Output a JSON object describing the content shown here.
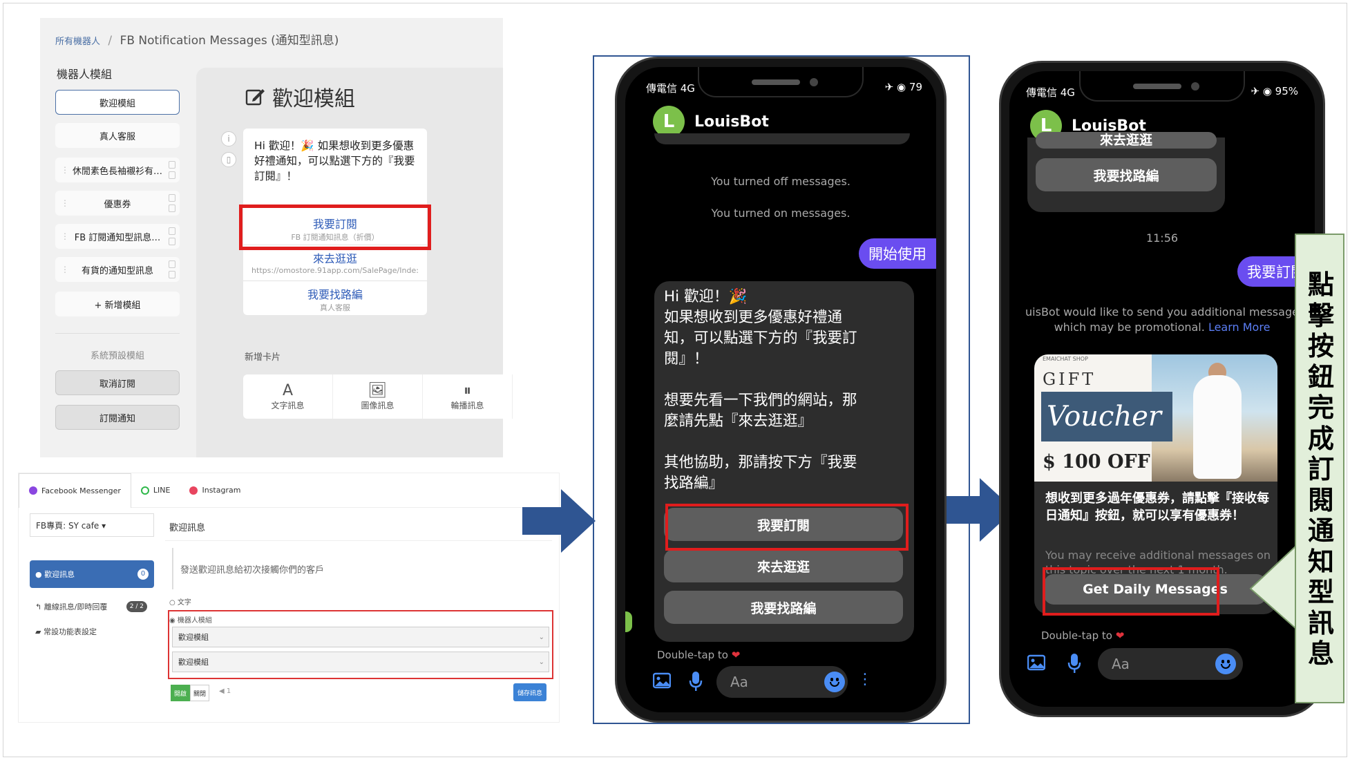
{
  "editor": {
    "breadcrumb_root": "所有機器人",
    "breadcrumb_sep": "/",
    "breadcrumb_current": "FB Notification Messages (通知型訊息)",
    "modules_heading": "機器人模組",
    "modules": [
      {
        "label": "歡迎模組"
      },
      {
        "label": "真人客服"
      },
      {
        "label": "休閒素色長袖襯衫有…"
      },
      {
        "label": "優惠券"
      },
      {
        "label": "FB 訂閱通知型訊息…"
      },
      {
        "label": "有貨的通知型訊息"
      },
      {
        "label": "+ 新增模組"
      }
    ],
    "system_heading": "系統預設模組",
    "system_modules": [
      "取消訂閱",
      "訂閱通知"
    ],
    "title": "歡迎模組",
    "card_text": "Hi 歡迎！🎉 如果想收到更多優惠好禮通知，可以點選下方的『我要訂閱』！",
    "card_buttons": [
      {
        "label": "我要訂閱",
        "sub": "FB 訂閱通知訊息（折價）"
      },
      {
        "label": "來去逛逛",
        "sub": "https://omostore.91app.com/SalePage/Inde:"
      },
      {
        "label": "我要找路編",
        "sub": "真人客服"
      }
    ],
    "add_card_label": "新增卡片",
    "add_types": [
      {
        "glyph": "A",
        "label": "文字訊息"
      },
      {
        "glyph": "🖼",
        "label": "圖像訊息"
      },
      {
        "glyph": "⏸",
        "label": "輪播訊息"
      }
    ]
  },
  "fbset": {
    "tabs": [
      {
        "label": "Facebook Messenger",
        "color": "#8a46e0"
      },
      {
        "label": "LINE",
        "color": "#2fb84a"
      },
      {
        "label": "Instagram",
        "color": "#e8455f"
      }
    ],
    "page_select": "FB專頁: SY cafe ▾",
    "nav_active": "● 歡迎訊息",
    "nav_active_badge": "0",
    "nav_items": [
      {
        "label": "↰ 離線訊息/即時回覆",
        "badge": "2 / 2"
      },
      {
        "label": "▰ 常設功能表設定",
        "badge": ""
      }
    ],
    "section_title": "歡迎訊息",
    "hint": "發送歡迎訊息給初次接觸你們的客戶",
    "option_text": "○ 文字",
    "option_bot": "◉ 機器人模組",
    "selects": [
      "歡迎模組",
      "歡迎模組"
    ],
    "toggle_on": "開啟",
    "toggle_off": "關閉",
    "counter": "◀ 1",
    "save": "儲存訊息"
  },
  "phone1": {
    "carrier": "傳電信 4G",
    "battery": "✈ ◉ 79",
    "bot_name": "LouisBot",
    "avatar": "L",
    "sys_off": "You turned off messages.",
    "sys_on": "You turned on messages.",
    "user_msg": "開始使用",
    "bot_lines": [
      "Hi 歡迎！🎉",
      "如果想收到更多優惠好禮通",
      "知，可以點選下方的『我要訂",
      "閱』！",
      "",
      "想要先看一下我們的網站，那",
      "麼請先點『來去逛逛』",
      "",
      "其他協助，那請按下方『我要",
      "找路編』"
    ],
    "quick_replies": [
      "我要訂閱",
      "來去逛逛",
      "我要找路編"
    ],
    "double_tap": "Double-tap to",
    "input_placeholder": "Aa"
  },
  "phone2": {
    "carrier": "傳電信 4G",
    "battery": "✈ ◉ 95%",
    "bot_name": "LouisBot",
    "avatar": "L",
    "partial_btn": "來去逛逛",
    "top_btn": "我要找路編",
    "time": "11:56",
    "user_msg": "我要訂閱",
    "notice_line1": "uisBot would like to send you additional message",
    "notice_line2": "which may be promotional.",
    "learn_more": "Learn More",
    "promo_tiny": "EMAICHAT SHOP",
    "promo_gift": "GIFT",
    "promo_voucher": "Voucher",
    "promo_off": "$ 100 OFF",
    "promo_text": "想收到更多過年優惠券，請點擊『接收每日通知』按鈕，就可以享有優惠券！",
    "promo_sub": "You may receive additional messages on this topic over the next 1 month.",
    "cta": "Get Daily Messages",
    "double_tap": "Double-tap to",
    "input_placeholder": "Aa"
  },
  "callout": {
    "text": "點擊按鈕完成訂閱通知型訊息"
  },
  "colors": {
    "messenger_purple": "#6a4df0",
    "highlight_red": "#e01d1d",
    "arrow_blue": "#2f5592",
    "callout_green": "#e2efda"
  }
}
